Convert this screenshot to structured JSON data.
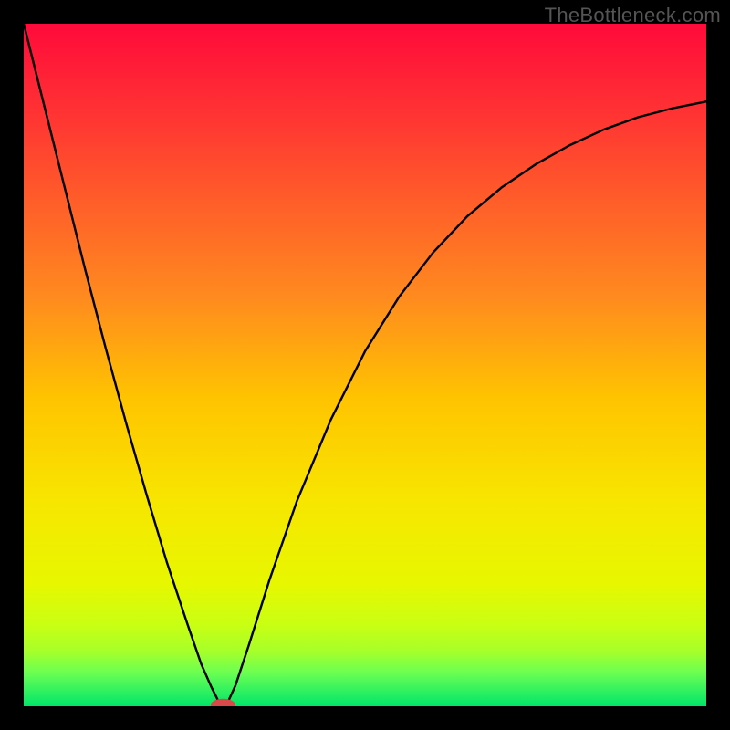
{
  "watermark": "TheBottleneck.com",
  "chart_data": {
    "type": "line",
    "title": "",
    "xlabel": "",
    "ylabel": "",
    "xlim": [
      0,
      100
    ],
    "ylim": [
      0,
      100
    ],
    "gradient_stops": [
      {
        "offset": 0,
        "color": "#ff0a3a"
      },
      {
        "offset": 12,
        "color": "#ff2f34"
      },
      {
        "offset": 25,
        "color": "#ff5a2a"
      },
      {
        "offset": 40,
        "color": "#ff8a1f"
      },
      {
        "offset": 55,
        "color": "#ffc400"
      },
      {
        "offset": 70,
        "color": "#f7e600"
      },
      {
        "offset": 82,
        "color": "#e7f700"
      },
      {
        "offset": 88,
        "color": "#c9ff13"
      },
      {
        "offset": 92,
        "color": "#a6ff2a"
      },
      {
        "offset": 95,
        "color": "#6cff52"
      },
      {
        "offset": 100,
        "color": "#00e56a"
      }
    ],
    "curve": [
      {
        "x": 0.0,
        "y": 100.0
      },
      {
        "x": 3.0,
        "y": 88.0
      },
      {
        "x": 6.0,
        "y": 76.0
      },
      {
        "x": 9.0,
        "y": 64.0
      },
      {
        "x": 12.0,
        "y": 52.5
      },
      {
        "x": 15.0,
        "y": 41.5
      },
      {
        "x": 18.0,
        "y": 31.0
      },
      {
        "x": 21.0,
        "y": 21.0
      },
      {
        "x": 24.0,
        "y": 12.0
      },
      {
        "x": 26.0,
        "y": 6.2
      },
      {
        "x": 27.5,
        "y": 2.8
      },
      {
        "x": 28.6,
        "y": 0.6
      },
      {
        "x": 29.2,
        "y": 0.0
      },
      {
        "x": 29.9,
        "y": 0.6
      },
      {
        "x": 31.0,
        "y": 3.0
      },
      {
        "x": 33.0,
        "y": 9.0
      },
      {
        "x": 36.0,
        "y": 18.5
      },
      {
        "x": 40.0,
        "y": 30.0
      },
      {
        "x": 45.0,
        "y": 42.0
      },
      {
        "x": 50.0,
        "y": 52.0
      },
      {
        "x": 55.0,
        "y": 60.0
      },
      {
        "x": 60.0,
        "y": 66.5
      },
      {
        "x": 65.0,
        "y": 71.8
      },
      {
        "x": 70.0,
        "y": 76.0
      },
      {
        "x": 75.0,
        "y": 79.4
      },
      {
        "x": 80.0,
        "y": 82.2
      },
      {
        "x": 85.0,
        "y": 84.5
      },
      {
        "x": 90.0,
        "y": 86.3
      },
      {
        "x": 95.0,
        "y": 87.6
      },
      {
        "x": 100.0,
        "y": 88.6
      }
    ],
    "marker": {
      "x": 29.2,
      "y": 0.2,
      "rx": 1.8,
      "ry": 0.9,
      "color": "#d84a4a"
    }
  }
}
